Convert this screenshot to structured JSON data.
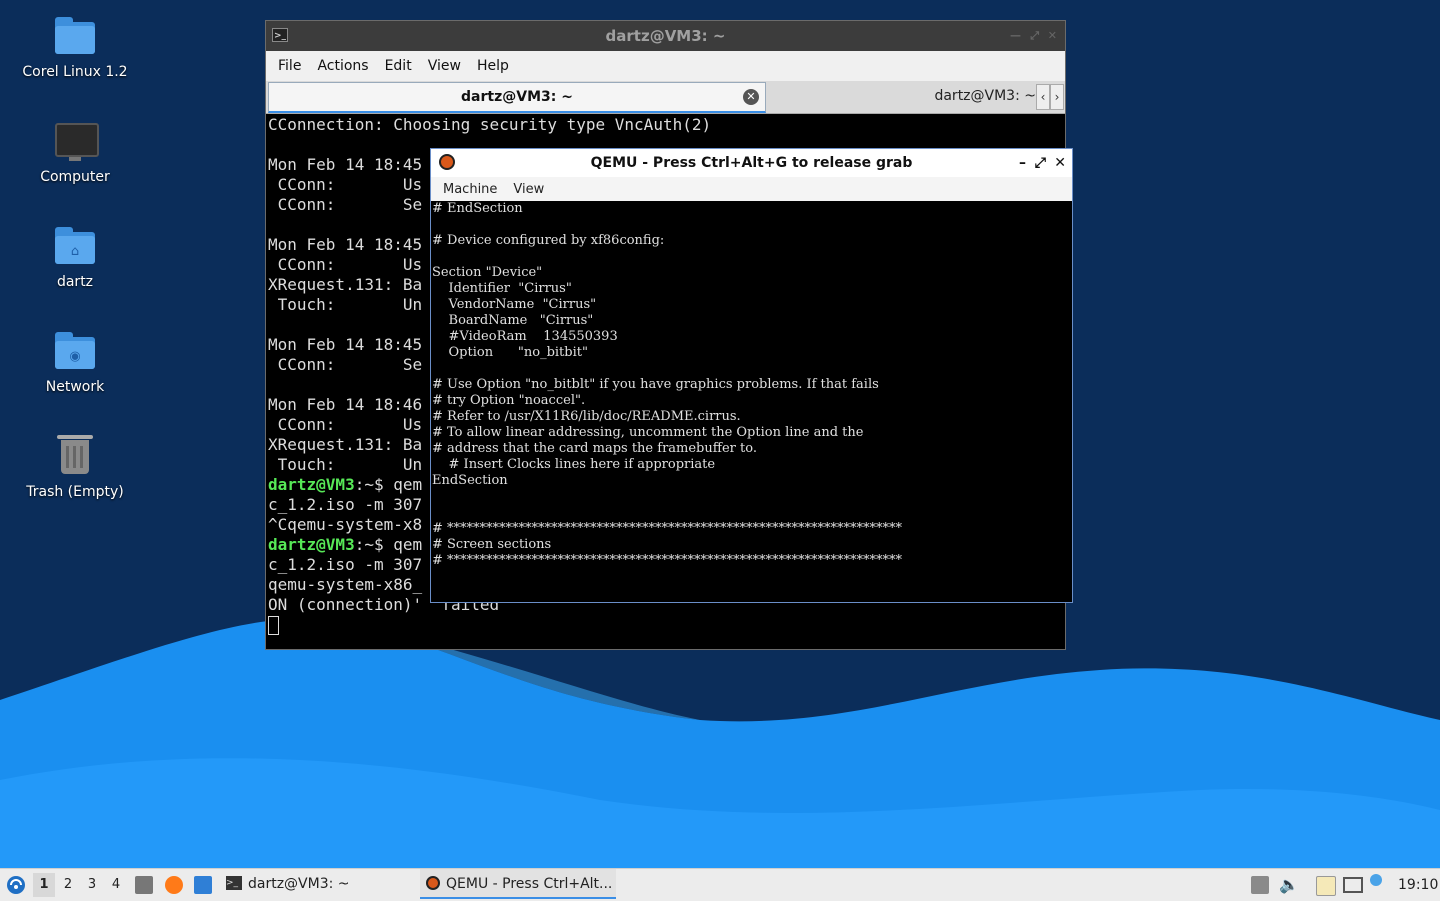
{
  "desktop": {
    "icons": [
      {
        "label": "Corel Linux 1.2"
      },
      {
        "label": "Computer"
      },
      {
        "label": "dartz"
      },
      {
        "label": "Network"
      },
      {
        "label": "Trash (Empty)"
      }
    ]
  },
  "terminal": {
    "title": "dartz@VM3: ~",
    "menu": [
      "File",
      "Actions",
      "Edit",
      "View",
      "Help"
    ],
    "tabs": [
      {
        "label": "dartz@VM3: ~"
      },
      {
        "label": "dartz@VM3: ~"
      }
    ],
    "lines": [
      "CConnection: Choosing security type VncAuth(2)",
      "",
      "Mon Feb 14 18:45",
      " CConn:       Us",
      " CConn:       Se",
      "",
      "Mon Feb 14 18:45",
      " CConn:       Us",
      "XRequest.131: Ba",
      " Touch:       Un",
      "",
      "Mon Feb 14 18:45",
      " CConn:       Se",
      "",
      "Mon Feb 14 18:46",
      " CConn:       Us",
      "XRequest.131: Ba",
      " Touch:       Un"
    ],
    "prompt1": "dartz@VM3",
    "prompt1_rest": ":~$ qem",
    "line_after1a": "c_1.2.iso -m 307",
    "line_after1b": "^Cqemu-system-x8",
    "prompt2": "dartz@VM3",
    "prompt2_rest": ":~$ qem",
    "line_after2a": "c_1.2.iso -m 307",
    "line_after2b": "qemu-system-x86_",
    "line_after2c": "ON (connection)'  failed"
  },
  "qemu": {
    "title": "QEMU - Press Ctrl+Alt+G to release grab",
    "menu": [
      "Machine",
      "View"
    ],
    "screen_lines": [
      "# EndSection",
      "",
      "# Device configured by xf86config:",
      "",
      "Section \"Device\"",
      "    Identifier  \"Cirrus\"",
      "    VendorName  \"Cirrus\"",
      "    BoardName   \"Cirrus\"",
      "    #VideoRam    134550393",
      "    Option      \"no_bitbit\"",
      "",
      "# Use Option \"no_bitblt\" if you have graphics problems. If that fails",
      "# try Option \"noaccel\".",
      "# Refer to /usr/X11R6/lib/doc/README.cirrus.",
      "# To allow linear addressing, uncomment the Option line and the",
      "# address that the card maps the framebuffer to.",
      "    # Insert Clocks lines here if appropriate",
      "EndSection",
      "",
      "",
      "# **********************************************************************",
      "# Screen sections",
      "# **********************************************************************"
    ]
  },
  "taskbar": {
    "workspaces": [
      "1",
      "2",
      "3",
      "4"
    ],
    "tasks": [
      {
        "label": "dartz@VM3: ~"
      },
      {
        "label": "QEMU - Press Ctrl+Alt..."
      }
    ],
    "clock": "19:10"
  }
}
